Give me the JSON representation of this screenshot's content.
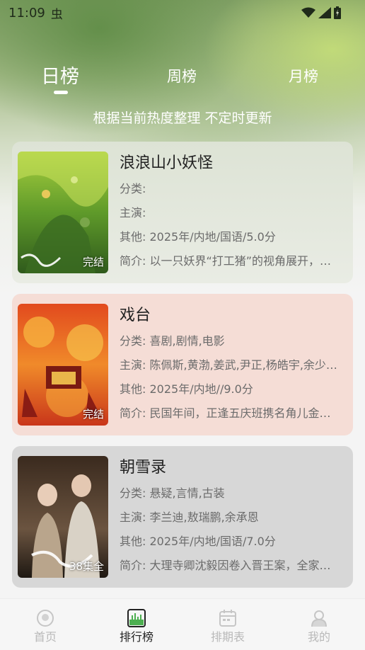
{
  "status": {
    "time": "11:09",
    "bug_glyph": "虫",
    "icons": [
      "wifi-icon",
      "signal-icon",
      "battery-icon"
    ]
  },
  "tabs": [
    {
      "label": "日榜",
      "active": true
    },
    {
      "label": "周榜",
      "active": false
    },
    {
      "label": "月榜",
      "active": false
    }
  ],
  "subtitle": "根据当前热度整理 不定时更新",
  "items": [
    {
      "title": "浪浪山小妖怪",
      "badge": "完结",
      "category": "分类:",
      "cast": "主演:",
      "other": "其他:  2025年/内地/国语/5.0分",
      "intro": "简介:  以一只妖界“打工猪”的视角展开，…"
    },
    {
      "title": "戏台",
      "badge": "完结",
      "category": "分类:  喜剧,剧情,电影",
      "cast": "主演:  陈佩斯,黄渤,姜武,尹正,杨皓宇,余少…",
      "other": "其他:  2025年/内地//9.0分",
      "intro": "简介:  民国年间，正逢五庆班携名角儿金…"
    },
    {
      "title": "朝雪录",
      "badge": "38集全",
      "category": "分类:  悬疑,言情,古装",
      "cast": "主演:  李兰迪,敖瑞鹏,余承恩",
      "other": "其他:  2025年/内地/国语/7.0分",
      "intro": "简介:  大理寺卿沈毅因卷入晋王案，全家…"
    }
  ],
  "nav": [
    {
      "label": "首页",
      "icon": "home-icon",
      "active": false
    },
    {
      "label": "排行榜",
      "icon": "ranking-icon",
      "active": true
    },
    {
      "label": "排期表",
      "icon": "calendar-icon",
      "active": false
    },
    {
      "label": "我的",
      "icon": "profile-icon",
      "active": false
    }
  ],
  "colors": {
    "active_nav": "#222222",
    "inactive_nav": "#b9b9b9",
    "ranking_accent": "#4caf50"
  }
}
